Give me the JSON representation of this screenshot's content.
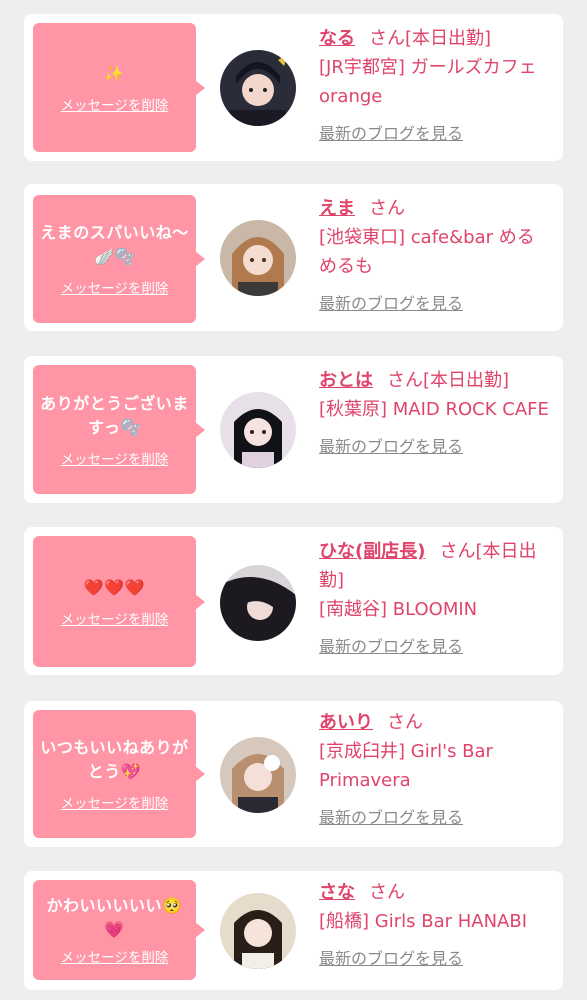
{
  "cards": [
    {
      "message": "✨",
      "delete_label": "メッセージを削除",
      "name": "なる",
      "san": "さん",
      "status": "[本日出勤]",
      "shop": "[JR宇都宮] ガールズカフェ orange",
      "blog_label": "最新のブログを見る"
    },
    {
      "message": "えまのスパいいね〜🪽🫧",
      "delete_label": "メッセージを削除",
      "name": "えま",
      "san": "さん",
      "status": "",
      "shop": "[池袋東口] cafe&bar めるめるも",
      "blog_label": "最新のブログを見る"
    },
    {
      "message": "ありがとうございますっ🫧",
      "delete_label": "メッセージを削除",
      "name": "おとは",
      "san": "さん",
      "status": "[本日出勤]",
      "shop": "[秋葉原] MAID ROCK CAFE",
      "blog_label": "最新のブログを見る"
    },
    {
      "message": "❤️❤️❤️",
      "delete_label": "メッセージを削除",
      "name": "ひな(副店長)",
      "san": "さん",
      "status": "[本日出勤]",
      "shop": "[南越谷] BLOOMIN",
      "blog_label": "最新のブログを見る"
    },
    {
      "message": "いつもいいねありがとう💖",
      "delete_label": "メッセージを削除",
      "name": "あいり",
      "san": "さん",
      "status": "",
      "shop": "[京成臼井] Girl's Bar Primavera",
      "blog_label": "最新のブログを見る"
    },
    {
      "message": "かわいいいいい🥺💗",
      "delete_label": "メッセージを削除",
      "name": "さな",
      "san": "さん",
      "status": "",
      "shop": "[船橋] Girls Bar HANABI",
      "blog_label": "最新のブログを見る"
    }
  ]
}
